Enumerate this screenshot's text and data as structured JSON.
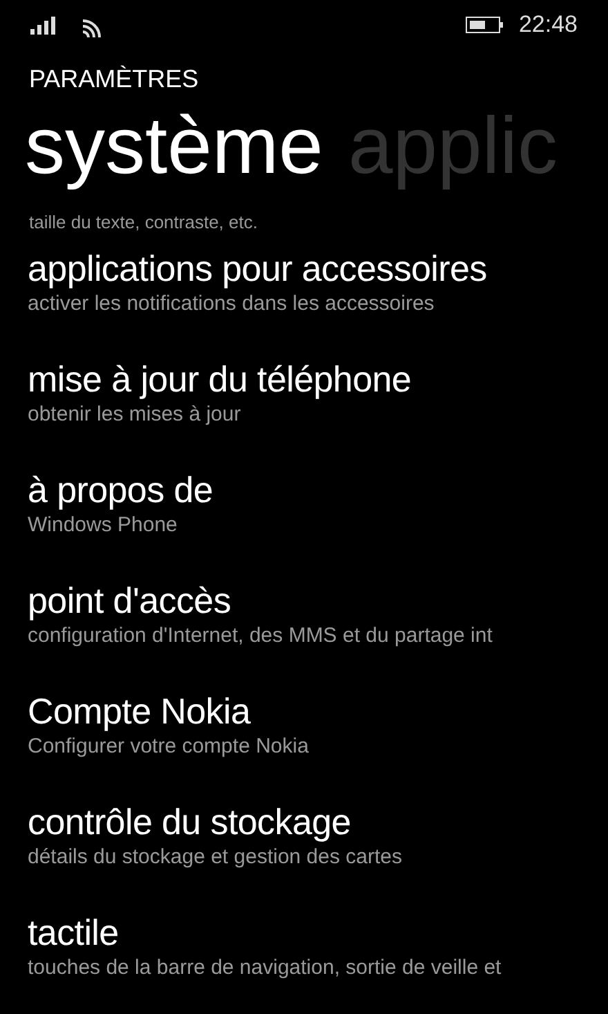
{
  "status_bar": {
    "time": "22:48"
  },
  "app_title": "PARAMÈTRES",
  "pivot": [
    {
      "label": "système",
      "selected": true
    },
    {
      "label": "applic",
      "selected": false
    }
  ],
  "partial_line": "taille du texte, contraste, etc.",
  "items": [
    {
      "title": "applications pour accessoires",
      "subtitle": "activer les notifications dans les accessoires"
    },
    {
      "title": "mise à jour du téléphone",
      "subtitle": "obtenir les mises à jour"
    },
    {
      "title": "à propos de",
      "subtitle": "Windows Phone"
    },
    {
      "title": "point d'accès",
      "subtitle": "configuration d'Internet, des MMS et du partage int"
    },
    {
      "title": "Compte Nokia",
      "subtitle": "Configurer votre compte Nokia"
    },
    {
      "title": "contrôle du stockage",
      "subtitle": "détails du stockage et gestion des cartes"
    },
    {
      "title": "tactile",
      "subtitle": "touches de la barre de navigation, sortie de veille et"
    }
  ]
}
